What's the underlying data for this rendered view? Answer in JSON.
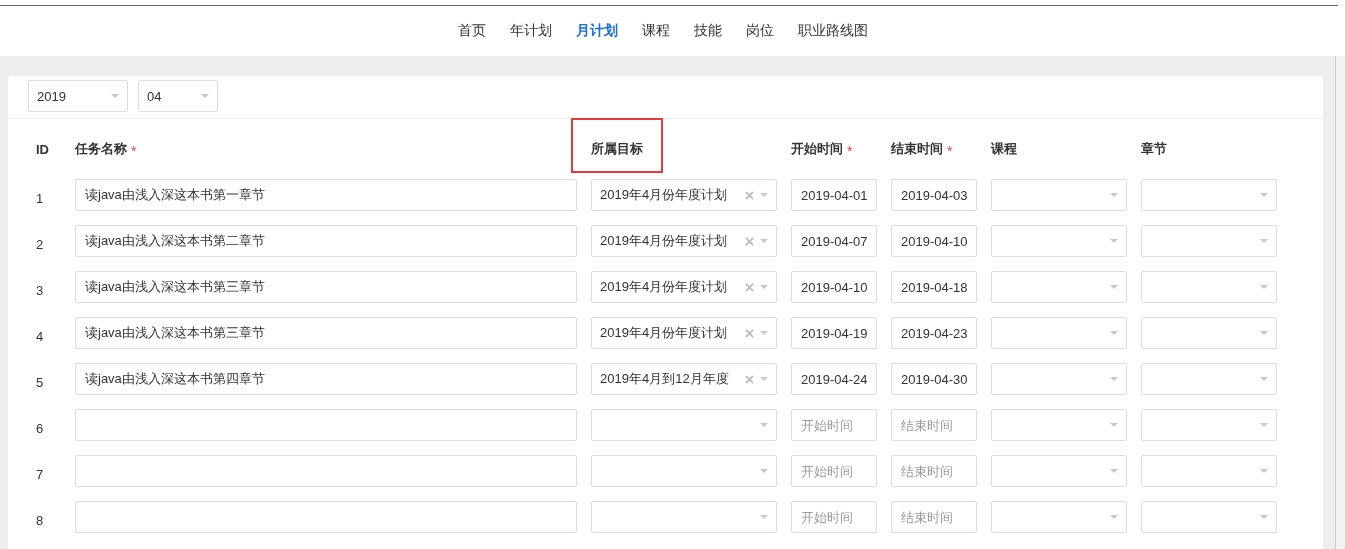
{
  "nav": [
    {
      "label": "首页",
      "selected": false
    },
    {
      "label": "年计划",
      "selected": false
    },
    {
      "label": "月计划",
      "selected": true
    },
    {
      "label": "课程",
      "selected": false
    },
    {
      "label": "技能",
      "selected": false
    },
    {
      "label": "岗位",
      "selected": false
    },
    {
      "label": "职业路线图",
      "selected": false
    }
  ],
  "filters": {
    "year": "2019",
    "month": "04"
  },
  "table": {
    "columns": [
      {
        "label": "ID",
        "highlighted": false
      },
      {
        "label": "任务名称",
        "required_mark": "*",
        "highlighted": false
      },
      {
        "label": "所属目标",
        "highlighted": true
      },
      {
        "label": "开始时间",
        "required_mark": "*",
        "highlighted": false
      },
      {
        "label": "结束时间",
        "required_mark": "*",
        "highlighted": false
      },
      {
        "label": "课程",
        "highlighted": false
      },
      {
        "label": "章节",
        "highlighted": false
      }
    ],
    "rows": [
      {
        "id": "1",
        "task": "读java由浅入深这本书第一章节",
        "goal": "2019年4月份年度计划",
        "start": "2019-04-01",
        "end": "2019-04-03"
      },
      {
        "id": "2",
        "task": "读java由浅入深这本书第二章节",
        "goal": "2019年4月份年度计划",
        "start": "2019-04-07",
        "end": "2019-04-10"
      },
      {
        "id": "3",
        "task": "读java由浅入深这本书第三章节",
        "goal": "2019年4月份年度计划",
        "start": "2019-04-10",
        "end": "2019-04-18"
      },
      {
        "id": "4",
        "task": "读java由浅入深这本书第三章节",
        "goal": "2019年4月份年度计划",
        "start": "2019-04-19",
        "end": "2019-04-23"
      },
      {
        "id": "5",
        "task": "读java由浅入深这本书第四章节",
        "goal": "2019年4月到12月年度",
        "start": "2019-04-24",
        "end": "2019-04-30"
      },
      {
        "id": "6",
        "start_placeholder": "开始时间",
        "end_placeholder": "结束时间"
      },
      {
        "id": "7",
        "start_placeholder": "开始时间",
        "end_placeholder": "结束时间"
      },
      {
        "id": "8",
        "start_placeholder": "开始时间",
        "end_placeholder": "结束时间"
      }
    ]
  }
}
